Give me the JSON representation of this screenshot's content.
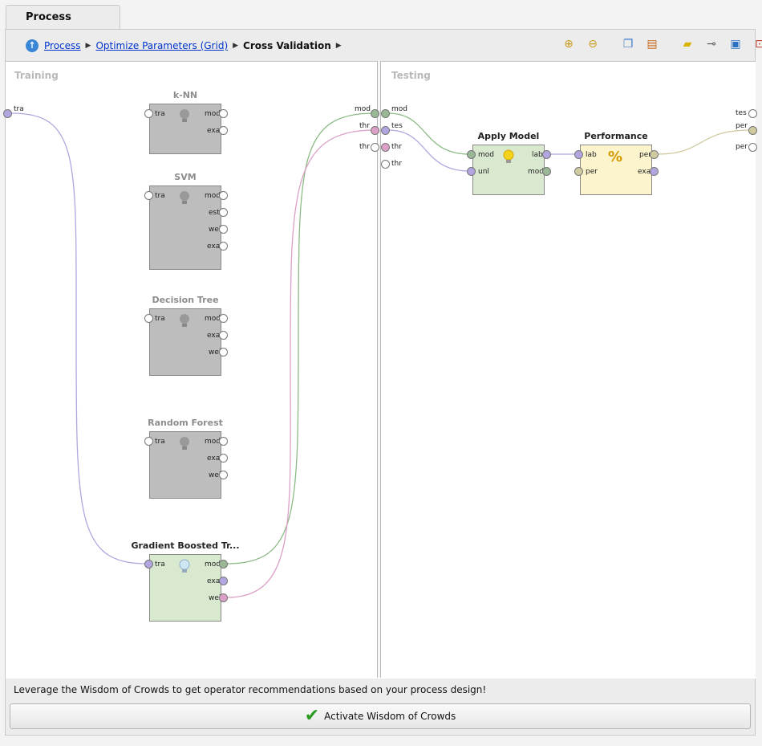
{
  "tab": {
    "title": "Process"
  },
  "breadcrumb": {
    "items": [
      "Process",
      "Optimize Parameters (Grid)"
    ],
    "current": "Cross Validation"
  },
  "toolbar": {
    "icons": [
      "zoom-in-icon",
      "zoom-out-icon",
      "copy-icon",
      "paste-icon",
      "add-note-icon",
      "auto-wire-icon",
      "layers-icon",
      "fit-icon"
    ]
  },
  "sections": {
    "training": "Training",
    "testing": "Testing"
  },
  "training_ports": {
    "left": "tra",
    "right_mod": "mod",
    "right_thr1": "thr",
    "right_thr2": "thr"
  },
  "testing_ports": {
    "left_mod": "mod",
    "left_tes": "tes",
    "left_thr1": "thr",
    "left_thr2": "thr",
    "right_tes": "tes",
    "right_per1": "per",
    "right_per2": "per"
  },
  "operators": {
    "knn": {
      "title": "k-NN",
      "in": [
        "tra"
      ],
      "out": [
        "mod",
        "exa"
      ]
    },
    "svm": {
      "title": "SVM",
      "in": [
        "tra"
      ],
      "out": [
        "mod",
        "est",
        "wei",
        "exa"
      ]
    },
    "dt": {
      "title": "Decision Tree",
      "in": [
        "tra"
      ],
      "out": [
        "mod",
        "exa",
        "wei"
      ]
    },
    "rf": {
      "title": "Random Forest",
      "in": [
        "tra"
      ],
      "out": [
        "mod",
        "exa",
        "wei"
      ]
    },
    "gbt": {
      "title": "Gradient Boosted Tr...",
      "in": [
        "tra"
      ],
      "out": [
        "mod",
        "exa",
        "wei"
      ]
    },
    "apply": {
      "title": "Apply Model",
      "in": [
        "mod",
        "unl"
      ],
      "out": [
        "lab",
        "mod"
      ]
    },
    "perf": {
      "title": "Performance",
      "in": [
        "lab",
        "per"
      ],
      "out": [
        "per",
        "exa"
      ]
    }
  },
  "footer": {
    "message": "Leverage the Wisdom of Crowds to get operator recommendations based on your process design!",
    "button": "Activate Wisdom of Crowds"
  },
  "colors": {
    "model_port": "#9ab896",
    "example_port": "#b3a5e0",
    "weight_port": "#dca0c8",
    "perf_port": "#cfcaa0"
  }
}
